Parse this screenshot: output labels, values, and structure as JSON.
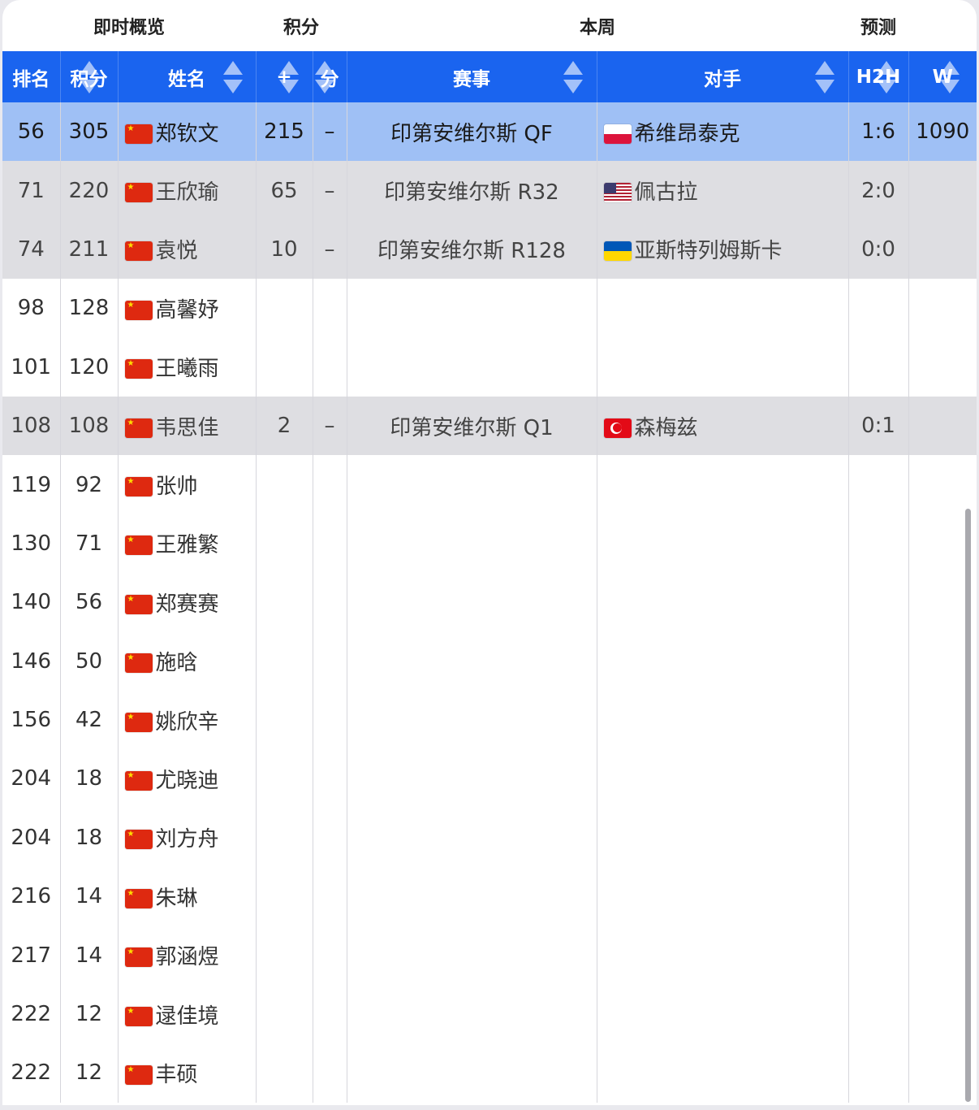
{
  "groups": {
    "overview": "即时概览",
    "points": "积分",
    "week": "本周",
    "forecast": "预测"
  },
  "columns": {
    "rank": "排名",
    "points": "积分",
    "name": "姓名",
    "plus": "+",
    "fen": "分",
    "event": "赛事",
    "opponent": "对手",
    "h2h": "H2H",
    "w": "W"
  },
  "rows": [
    {
      "rank": "56",
      "points": "305",
      "flag": "cn",
      "name": "郑钦文",
      "plus": "215",
      "dash": "–",
      "event": "印第安维尔斯 QF",
      "opp_flag": "pl",
      "opponent": "希维昂泰克",
      "h2h": "1:6",
      "w": "1090",
      "style": "hl"
    },
    {
      "rank": "71",
      "points": "220",
      "flag": "cn",
      "name": "王欣瑜",
      "plus": "65",
      "dash": "–",
      "event": "印第安维尔斯 R32",
      "opp_flag": "us",
      "opponent": "佩古拉",
      "h2h": "2:0",
      "w": "",
      "style": "gray"
    },
    {
      "rank": "74",
      "points": "211",
      "flag": "cn",
      "name": "袁悦",
      "plus": "10",
      "dash": "–",
      "event": "印第安维尔斯 R128",
      "opp_flag": "ua",
      "opponent": "亚斯特列姆斯卡",
      "h2h": "0:0",
      "w": "",
      "style": "gray"
    },
    {
      "rank": "98",
      "points": "128",
      "flag": "cn",
      "name": "高馨妤",
      "plus": "",
      "dash": "",
      "event": "",
      "opp_flag": "",
      "opponent": "",
      "h2h": "",
      "w": "",
      "style": ""
    },
    {
      "rank": "101",
      "points": "120",
      "flag": "cn",
      "name": "王曦雨",
      "plus": "",
      "dash": "",
      "event": "",
      "opp_flag": "",
      "opponent": "",
      "h2h": "",
      "w": "",
      "style": ""
    },
    {
      "rank": "108",
      "points": "108",
      "flag": "cn",
      "name": "韦思佳",
      "plus": "2",
      "dash": "–",
      "event": "印第安维尔斯 Q1",
      "opp_flag": "tr",
      "opponent": "森梅兹",
      "h2h": "0:1",
      "w": "",
      "style": "gray"
    },
    {
      "rank": "119",
      "points": "92",
      "flag": "cn",
      "name": "张帅",
      "plus": "",
      "dash": "",
      "event": "",
      "opp_flag": "",
      "opponent": "",
      "h2h": "",
      "w": "",
      "style": ""
    },
    {
      "rank": "130",
      "points": "71",
      "flag": "cn",
      "name": "王雅繁",
      "plus": "",
      "dash": "",
      "event": "",
      "opp_flag": "",
      "opponent": "",
      "h2h": "",
      "w": "",
      "style": ""
    },
    {
      "rank": "140",
      "points": "56",
      "flag": "cn",
      "name": "郑赛赛",
      "plus": "",
      "dash": "",
      "event": "",
      "opp_flag": "",
      "opponent": "",
      "h2h": "",
      "w": "",
      "style": ""
    },
    {
      "rank": "146",
      "points": "50",
      "flag": "cn",
      "name": "施晗",
      "plus": "",
      "dash": "",
      "event": "",
      "opp_flag": "",
      "opponent": "",
      "h2h": "",
      "w": "",
      "style": ""
    },
    {
      "rank": "156",
      "points": "42",
      "flag": "cn",
      "name": "姚欣辛",
      "plus": "",
      "dash": "",
      "event": "",
      "opp_flag": "",
      "opponent": "",
      "h2h": "",
      "w": "",
      "style": ""
    },
    {
      "rank": "204",
      "points": "18",
      "flag": "cn",
      "name": "尤晓迪",
      "plus": "",
      "dash": "",
      "event": "",
      "opp_flag": "",
      "opponent": "",
      "h2h": "",
      "w": "",
      "style": ""
    },
    {
      "rank": "204",
      "points": "18",
      "flag": "cn",
      "name": "刘方舟",
      "plus": "",
      "dash": "",
      "event": "",
      "opp_flag": "",
      "opponent": "",
      "h2h": "",
      "w": "",
      "style": ""
    },
    {
      "rank": "216",
      "points": "14",
      "flag": "cn",
      "name": "朱琳",
      "plus": "",
      "dash": "",
      "event": "",
      "opp_flag": "",
      "opponent": "",
      "h2h": "",
      "w": "",
      "style": ""
    },
    {
      "rank": "217",
      "points": "14",
      "flag": "cn",
      "name": "郭涵煜",
      "plus": "",
      "dash": "",
      "event": "",
      "opp_flag": "",
      "opponent": "",
      "h2h": "",
      "w": "",
      "style": ""
    },
    {
      "rank": "222",
      "points": "12",
      "flag": "cn",
      "name": "逯佳境",
      "plus": "",
      "dash": "",
      "event": "",
      "opp_flag": "",
      "opponent": "",
      "h2h": "",
      "w": "",
      "style": ""
    },
    {
      "rank": "222",
      "points": "12",
      "flag": "cn",
      "name": "丰硕",
      "plus": "",
      "dash": "",
      "event": "",
      "opp_flag": "",
      "opponent": "",
      "h2h": "",
      "w": "",
      "style": ""
    }
  ]
}
